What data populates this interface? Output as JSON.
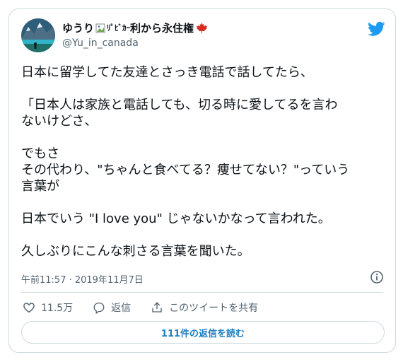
{
  "author": {
    "name_part1": "ゆうり",
    "name_broken_alt": "ﾘﾟﾋﾞｶｰ",
    "name_part2": "利から永住権",
    "handle": "@Yu_in_canada"
  },
  "tweet": {
    "lines": [
      "日本に留学してた友達とさっき電話で話してたら、",
      "",
      "「日本人は家族と電話しても、切る時に愛してるを言わ",
      "ないけどさ、",
      "",
      "でもさ",
      "その代わり、\"ちゃんと食べてる？痩せてない？\"っていう",
      "言葉が",
      "",
      "日本でいう \"I love you\" じゃないかなって言われた。",
      "",
      "久しぶりにこんな刺さる言葉を聞いた。"
    ],
    "timestamp": "午前11:57 · 2019年11月7日"
  },
  "actions": {
    "likes": "11.5万",
    "reply_label": "返信",
    "share_label": "このツイートを共有"
  },
  "replies_button": "111件の返信を読む",
  "colors": {
    "twitter_blue": "#1d9bf0",
    "link_blue": "#1d7ec0",
    "maple_red": "#d52b1e",
    "secondary_text": "#536471"
  },
  "icons": [
    "avatar-image",
    "broken-image-icon",
    "maple-leaf-icon",
    "twitter-bird-icon",
    "info-icon",
    "heart-icon",
    "reply-icon",
    "share-icon"
  ]
}
